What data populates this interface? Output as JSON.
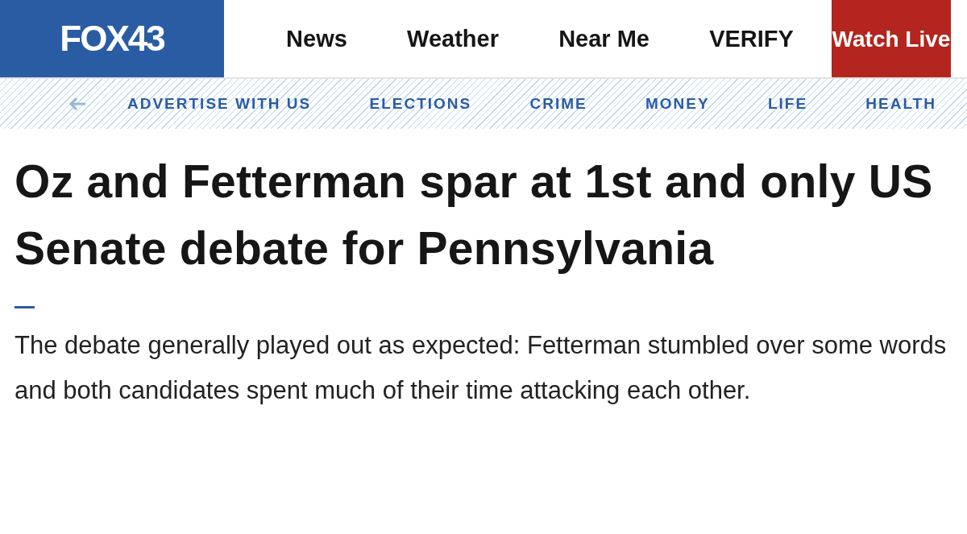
{
  "logo": "FOX43",
  "nav": [
    "News",
    "Weather",
    "Near Me",
    "VERIFY"
  ],
  "watch_live": "Watch Live",
  "subnav": [
    "ADVERTISE WITH US",
    "ELECTIONS",
    "CRIME",
    "MONEY",
    "LIFE",
    "HEALTH"
  ],
  "headline": "Oz and Fetterman spar at 1st and only US Senate debate for Pennsylvania",
  "summary": "The debate generally played out as expected: Fetterman stumbled over some words and both candidates spent much of their time attacking each other."
}
